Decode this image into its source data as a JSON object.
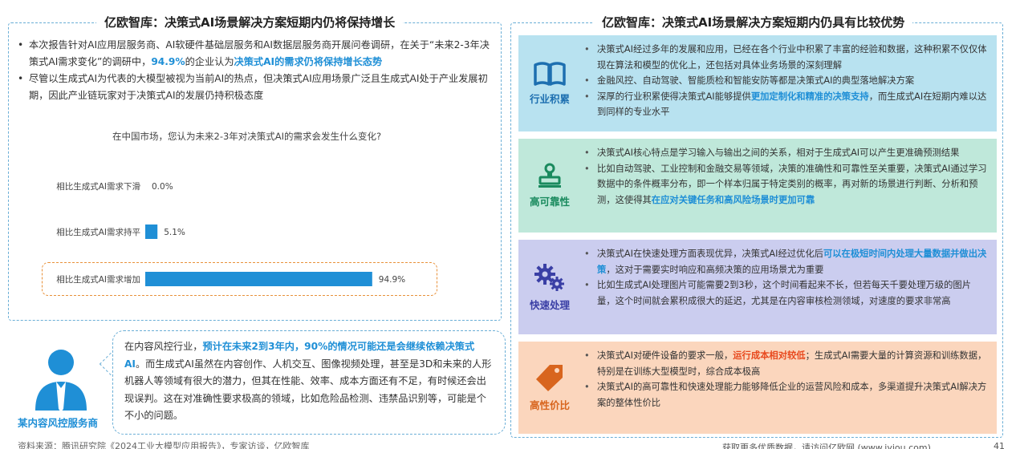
{
  "left": {
    "title": "亿欧智库：决策式AI场景解决方案短期内仍将保持增长",
    "bullet1": {
      "text_a": "本次报告针对AI应用层服务商、AI软硬件基础层服务和AI数据层服务商开展问卷调研，在关于“未来2-3年决策式AI需求变化”的调研中，",
      "highlight_a": "94.9%",
      "text_b": "的企业认为",
      "highlight_b": "决策式AI的需求仍将保持增长态势"
    },
    "bullet2": "尽管以生成式AI为代表的大模型被视为当前AI的热点，但决策式AI应用场景广泛且生成式AI处于产业发展初期，因此产业链玩家对于决策式AI的发展仍持积极态度",
    "chart_title": "在中国市场，您认为未来2-3年对决策式AI的需求会发生什么变化?"
  },
  "chart_data": {
    "type": "bar",
    "orientation": "horizontal",
    "title": "在中国市场，您认为未来2-3年对决策式AI的需求会发生什么变化?",
    "categories": [
      "相比生成式AI需求下滑",
      "相比生成式AI需求持平",
      "相比生成式AI需求增加"
    ],
    "values": [
      0.0,
      5.1,
      94.9
    ],
    "value_labels": [
      "0.0%",
      "5.1%",
      "94.9%"
    ],
    "unit": "%",
    "xlim": [
      0,
      100
    ],
    "bar_color": "#1f8fd6",
    "highlighted_category": "相比生成式AI需求增加"
  },
  "speaker": {
    "label": "某内容风控服务商"
  },
  "quote": {
    "text_a": "在内容风控行业，",
    "highlight": "预计在未来2到3年内，90%的情况可能还是会继续依赖决策式AI",
    "text_b": "。而生成式AI虽然在内容创作、人机交互、图像视频处理，甚至是3D和未来的人形机器人等领域有很大的潜力，但其在性能、效率、成本方面还有不足，有时候还会出现误判。这在对准确性要求极高的领域，比如危险品检测、违禁品识别等，可能是个不小的问题。"
  },
  "source": "资料来源：腾讯研究院《2024工业大模型应用报告》，专家访谈，亿欧智库",
  "right": {
    "title": "亿欧智库：决策式AI场景解决方案短期内仍具有比较优势",
    "cards": [
      {
        "label": "行业积累",
        "icon": "book-icon",
        "color": "#1d6fb0",
        "items": [
          {
            "a": "决策式AI经过多年的发展和应用，已经在各个行业中积累了丰富的经验和数据，这种积累不仅仅体现在算法和模型的优化上，还包括对具体业务场景的深刻理解",
            "h": "",
            "b": ""
          },
          {
            "a": "金融风控、自动驾驶、智能质检和智能安防等都是决策式AI的典型落地解决方案",
            "h": "",
            "b": ""
          },
          {
            "a": "深厚的行业积累使得决策式AI能够提供",
            "h": "更加定制化和精准的决策支持",
            "b": "，而生成式AI在短期内难以达到同样的专业水平"
          }
        ]
      },
      {
        "label": "高可靠性",
        "icon": "stamp-icon",
        "color": "#1a8a5e",
        "items": [
          {
            "a": "决策式AI核心特点是学习输入与输出之间的关系，相对于生成式AI可以产生更准确预测结果",
            "h": "",
            "b": ""
          },
          {
            "a": "比如自动驾驶、工业控制和金融交易等领域，决策的准确性和可靠性至关重要，决策式AI通过学习数据中的条件概率分布，即一个样本归属于特定类别的概率，再对新的场景进行判断、分析和预测，这使得其",
            "h": "在应对关键任务和高风险场景时更加可靠",
            "b": ""
          }
        ]
      },
      {
        "label": "快速处理",
        "icon": "gears-icon",
        "color": "#3a3fa5",
        "items": [
          {
            "a": "决策式AI在快速处理方面表现优异，决策式AI经过优化后",
            "h": "可以在极短时间内处理大量数据并做出决策",
            "b": "，这对于需要实时响应和高频决策的应用场景尤为重要"
          },
          {
            "a": "比如生成式AI处理图片可能需要2到3秒，这个时间看起来不长，但若每天千要处理万级的图片量，这个时间就会累积成很大的延迟，尤其是在内容审核检测领域，对速度的要求非常高",
            "h": "",
            "b": ""
          }
        ]
      },
      {
        "label": "高性价比",
        "icon": "price-tag-icon",
        "color": "#d8651e",
        "items": [
          {
            "a": "决策式AI对硬件设备的要求一般，",
            "h": "运行成本相对较低",
            "b": "；生成式AI需要大量的计算资源和训练数据，特别是在训练大型模型时，综合成本极高"
          },
          {
            "a": "决策式AI的高可靠性和快速处理能力能够降低企业的运营风险和成本，多渠道提升决策式AI解决方案的整体性价比",
            "h": "",
            "b": ""
          }
        ]
      }
    ]
  },
  "footer": {
    "right_text": "获取更多优质数据，请访问亿欧网 (www.iyiou.com)",
    "page": "41"
  }
}
